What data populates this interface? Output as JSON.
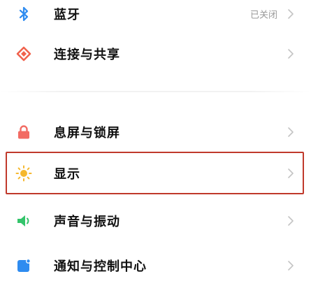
{
  "settings": {
    "items": [
      {
        "label": "蓝牙",
        "value": "已关闭",
        "icon": "bluetooth-icon",
        "color": "#2f8cf0"
      },
      {
        "label": "连接与共享",
        "value": "",
        "icon": "connection-sharing-icon",
        "color": "#f0624d"
      },
      {
        "label": "息屏与锁屏",
        "value": "",
        "icon": "lock-icon",
        "color": "#f26b63"
      },
      {
        "label": "显示",
        "value": "",
        "icon": "sun-icon",
        "color": "#f5b82e"
      },
      {
        "label": "声音与振动",
        "value": "",
        "icon": "speaker-icon",
        "color": "#34c46b"
      },
      {
        "label": "通知与控制中心",
        "value": "",
        "icon": "notification-icon",
        "color": "#2f8cf0"
      }
    ]
  },
  "highlight": {
    "target": "显示",
    "color": "#c0392b"
  },
  "chevron_color": "#c4c4c4"
}
